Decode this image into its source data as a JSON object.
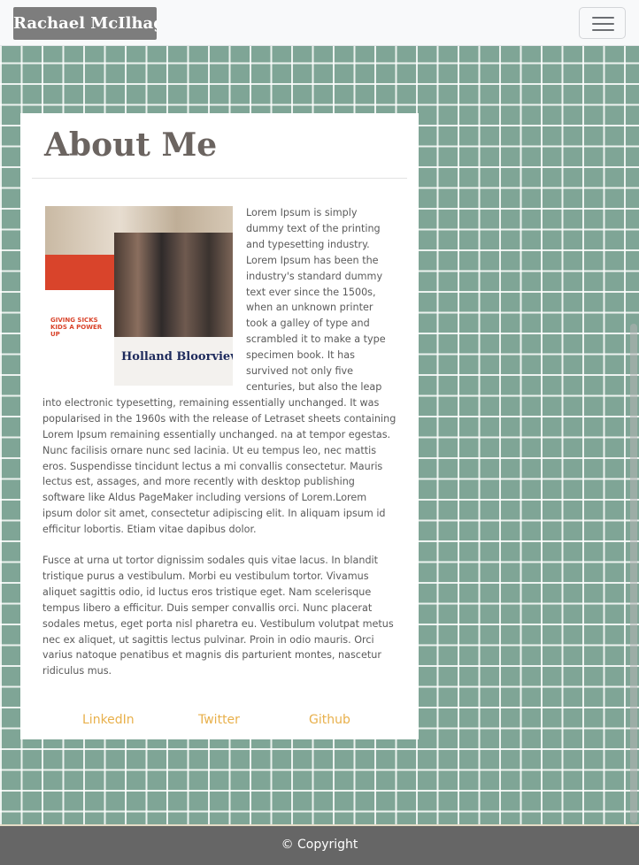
{
  "navbar": {
    "brand": "Rachael McIlhagga",
    "toggler_icon": "hamburger-menu-icon"
  },
  "about": {
    "title": "About Me",
    "photo_caption": "Holland Bloorview",
    "banner_text": "GIVING SICKS KIDS A POWER UP",
    "paragraph_1": "Lorem Ipsum is simply dummy text of the printing and typesetting industry. Lorem Ipsum has been the industry's standard dummy text ever since the 1500s, when an unknown printer took a galley of type and scrambled it to make a type specimen book. It has survived not only five centuries, but also the leap into electronic typesetting, remaining essentially unchanged. It was popularised in the 1960s with the release of Letraset sheets containing Lorem Ipsum remaining essentially unchanged. na at tempor egestas. Nunc facilisis ornare nunc sed lacinia. Ut eu tempus leo, nec mattis eros. Suspendisse tincidunt lectus a mi convallis consectetur. Mauris lectus est, assages, and more recently with desktop publishing software like Aldus PageMaker including versions of Lorem.Lorem ipsum dolor sit amet, consectetur adipiscing elit. In aliquam ipsum id efficitur lobortis. Etiam vitae dapibus dolor.",
    "paragraph_2": "Fusce at urna ut tortor dignissim sodales quis vitae lacus. In blandit tristique purus a vestibulum. Morbi eu vestibulum tortor. Vivamus aliquet sagittis odio, id luctus eros tristique eget. Nam scelerisque tempus libero a efficitur. Duis semper convallis orci. Nunc placerat sodales metus, eget porta nisl pharetra eu. Vestibulum volutpat metus nec ex aliquet, ut sagittis lectus pulvinar. Proin in odio mauris. Orci varius natoque penatibus et magnis dis parturient montes, nascetur ridiculus mus."
  },
  "social_links": {
    "linkedin": "LinkedIn",
    "twitter": "Twitter",
    "github": "Github"
  },
  "footer": {
    "copyright": "© Copyright"
  },
  "colors": {
    "background": "#7fa596",
    "grid_lines": "#ffffff",
    "link": "#e8b04b",
    "footer": "#666666",
    "title": "#6b6460"
  }
}
